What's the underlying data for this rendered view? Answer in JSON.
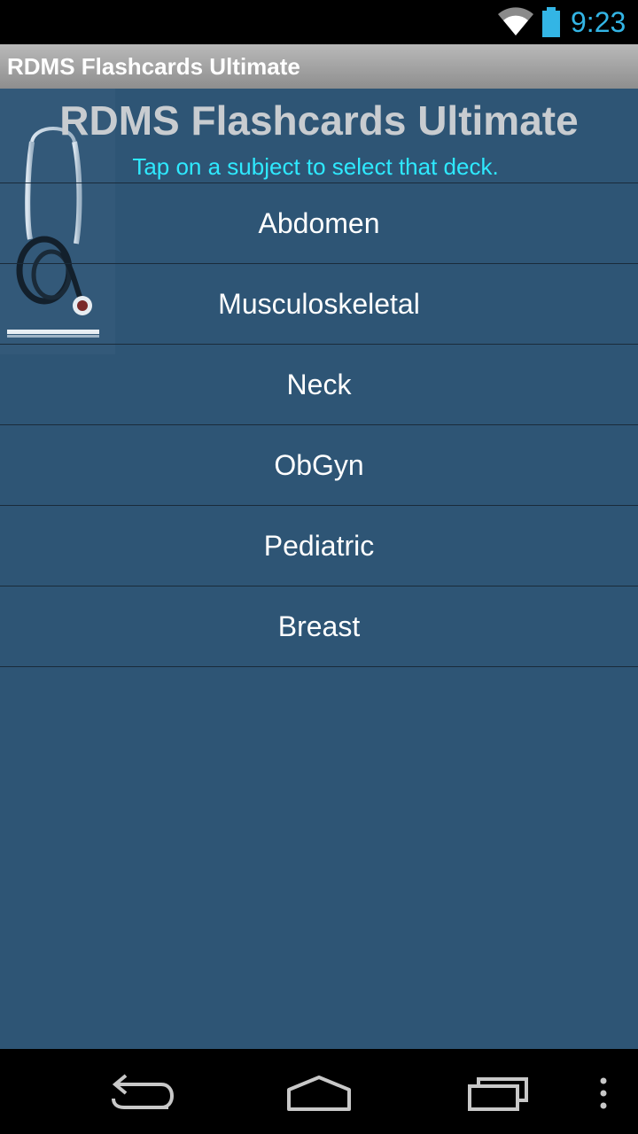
{
  "status_bar": {
    "time": "9:23",
    "icons": [
      "wifi-icon",
      "battery-icon"
    ],
    "accent_color": "#33b5e5"
  },
  "action_bar": {
    "title": "RDMS Flashcards Ultimate"
  },
  "main": {
    "heading": "RDMS Flashcards Ultimate",
    "instruction": "Tap on a subject to select that deck.",
    "subjects": [
      {
        "label": "Abdomen"
      },
      {
        "label": "Musculoskeletal"
      },
      {
        "label": "Neck"
      },
      {
        "label": "ObGyn"
      },
      {
        "label": "Pediatric"
      },
      {
        "label": "Breast"
      }
    ],
    "background_color": "#2e5575",
    "instruction_color": "#2ee9ff"
  },
  "nav_bar": {
    "icons": [
      "back-icon",
      "home-icon",
      "recent-apps-icon",
      "overflow-menu-icon"
    ]
  }
}
